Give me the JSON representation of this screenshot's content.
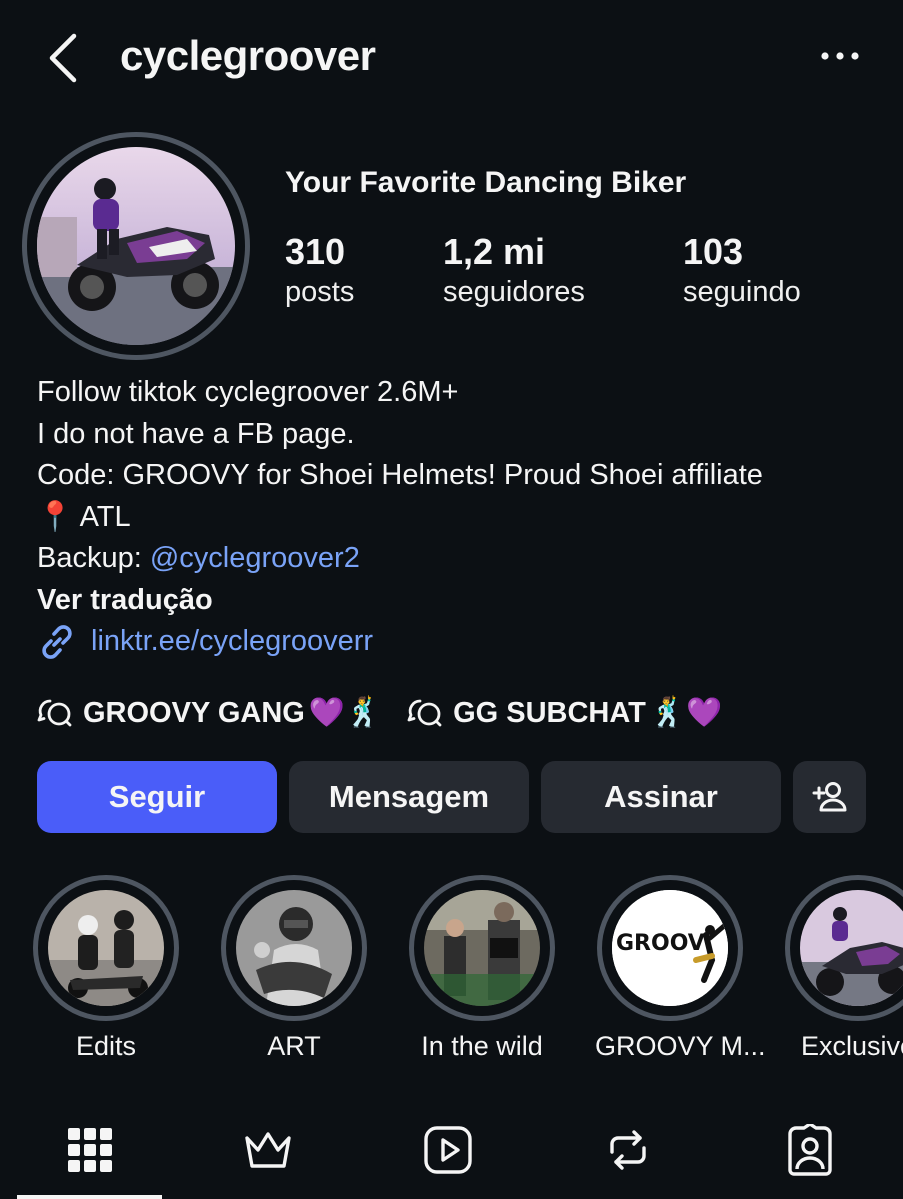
{
  "header": {
    "username": "cyclegroover",
    "back_icon": "chevron-left-icon",
    "more_icon": "more-horizontal-icon"
  },
  "profile": {
    "full_name": "Your Favorite Dancing Biker",
    "stats": [
      {
        "value": "310",
        "label": "posts"
      },
      {
        "value": "1,2 mi",
        "label": "seguidores"
      },
      {
        "value": "103",
        "label": "seguindo"
      }
    ]
  },
  "bio": {
    "line1": "Follow tiktok cyclegroover 2.6M+",
    "line2": "I do not have a FB page.",
    "line3": "Code: GROOVY for Shoei Helmets! Proud Shoei affiliate",
    "pin_emoji": "📍",
    "line4": "ATL",
    "backup_prefix": "Backup:",
    "backup_handle": "@cyclegroover2",
    "translate_label": "Ver tradução",
    "link_text": "linktr.ee/cyclegrooverr"
  },
  "channels": [
    {
      "label": "GROOVY GANG",
      "emojis": "💜🕺"
    },
    {
      "label": "GG SUBCHAT",
      "emojis": "🕺💜"
    }
  ],
  "actions": {
    "follow_label": "Seguir",
    "message_label": "Mensagem",
    "subscribe_label": "Assinar",
    "add_user_icon": "person-add-icon"
  },
  "highlights": [
    {
      "label": "Edits"
    },
    {
      "label": "ART"
    },
    {
      "label": "In the wild"
    },
    {
      "label": "GROOVY M..."
    },
    {
      "label": "Exclusive"
    }
  ],
  "highlight_logo_text": "GROOV",
  "tabs": [
    {
      "icon": "grid-icon",
      "active": true
    },
    {
      "icon": "crown-icon",
      "active": false
    },
    {
      "icon": "reels-icon",
      "active": false
    },
    {
      "icon": "repost-icon",
      "active": false
    },
    {
      "icon": "tagged-icon",
      "active": false
    }
  ],
  "colors": {
    "background": "#0c1014",
    "primary_button": "#4a5df9",
    "secondary_button": "#262a31",
    "link": "#7aa3f7"
  }
}
